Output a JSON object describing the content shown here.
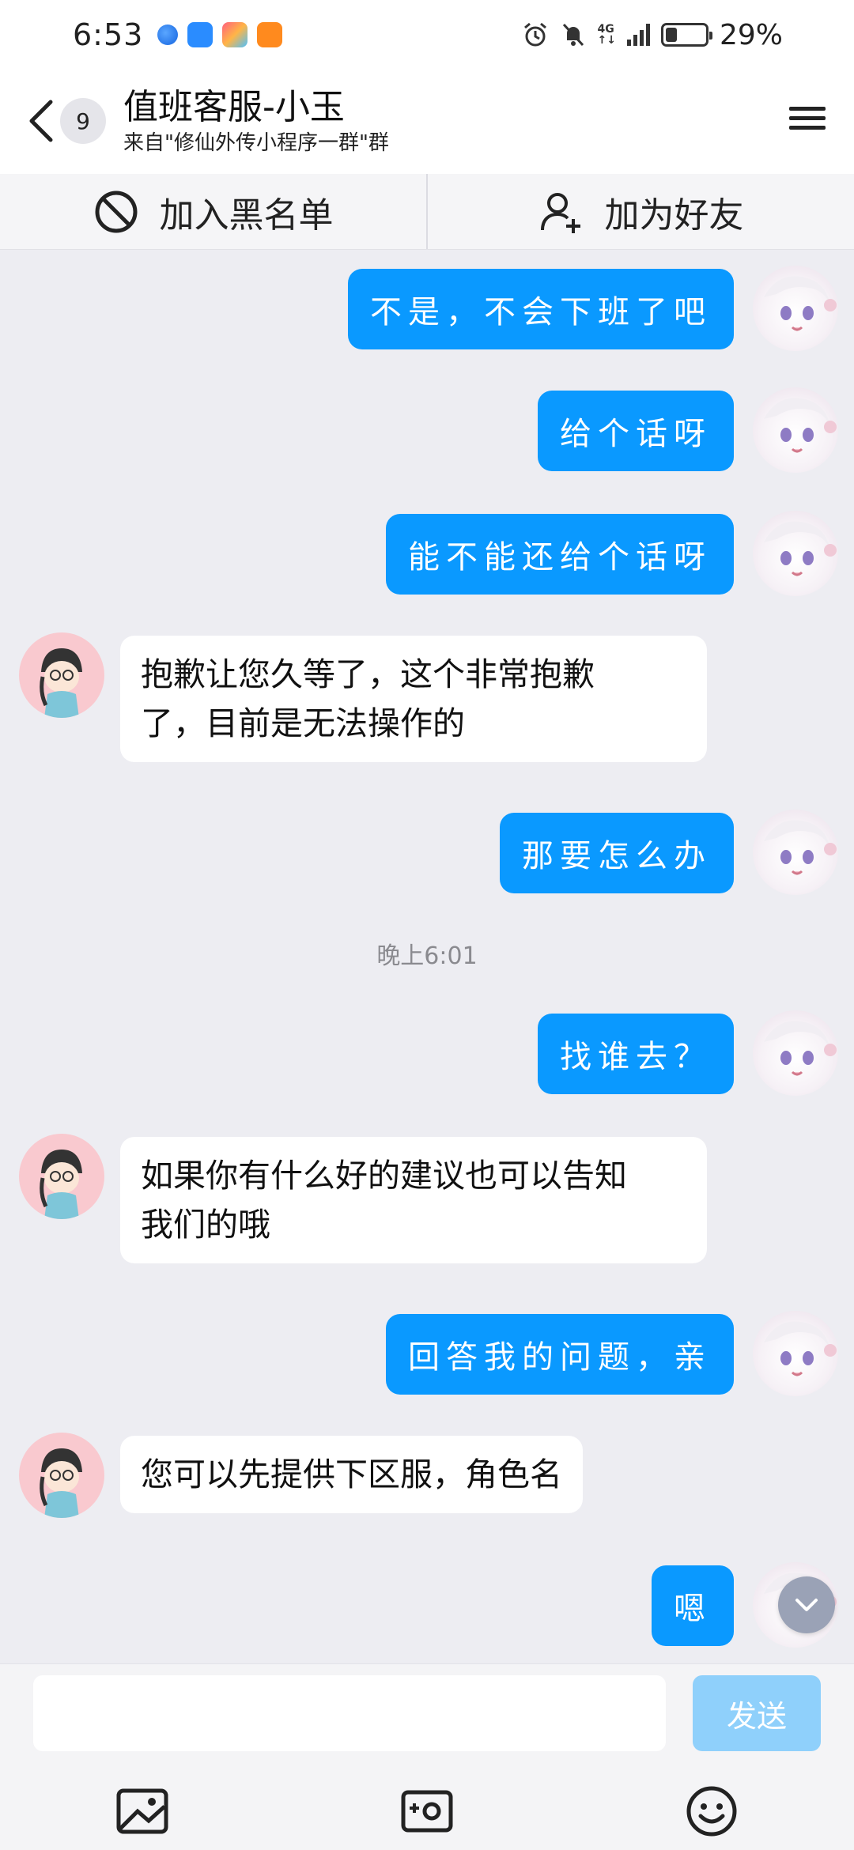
{
  "status_bar": {
    "time": "6:53",
    "network_label_top": "4G",
    "network_label_bottom": "↑↓",
    "battery_percent": "29%",
    "battery_level": 0.29
  },
  "header": {
    "unread_count": "9",
    "title": "值班客服-小玉",
    "subtitle": "来自\"修仙外传小程序一群\"群"
  },
  "actions": {
    "blacklist_label": "加入黑名单",
    "add_friend_label": "加为好友"
  },
  "messages": [
    {
      "from": "self",
      "text": "不是，不会下班了吧"
    },
    {
      "from": "self",
      "text": "给个话呀"
    },
    {
      "from": "self",
      "text": "能不能还给个话呀"
    },
    {
      "from": "other",
      "lines": [
        "抱歉让您久等了，这个非常抱歉",
        "了，目前是无法操作的"
      ]
    },
    {
      "from": "self",
      "text": "那要怎么办"
    },
    {
      "from": "self",
      "text": "找谁去？"
    },
    {
      "from": "other",
      "lines": [
        "如果你有什么好的建议也可以告知",
        "我们的哦"
      ]
    },
    {
      "from": "self",
      "text": "回答我的问题，亲"
    },
    {
      "from": "other",
      "lines": [
        "您可以先提供下区服，角色名"
      ]
    },
    {
      "from": "self",
      "text": "嗯"
    }
  ],
  "time_divider": "晚上6:01",
  "composer": {
    "placeholder": "",
    "send_label": "发送"
  },
  "colors": {
    "outgoing_bubble": "#0a99ff",
    "incoming_bubble": "#ffffff",
    "chat_background": "#ededf2",
    "send_disabled": "#8fd0fb"
  }
}
